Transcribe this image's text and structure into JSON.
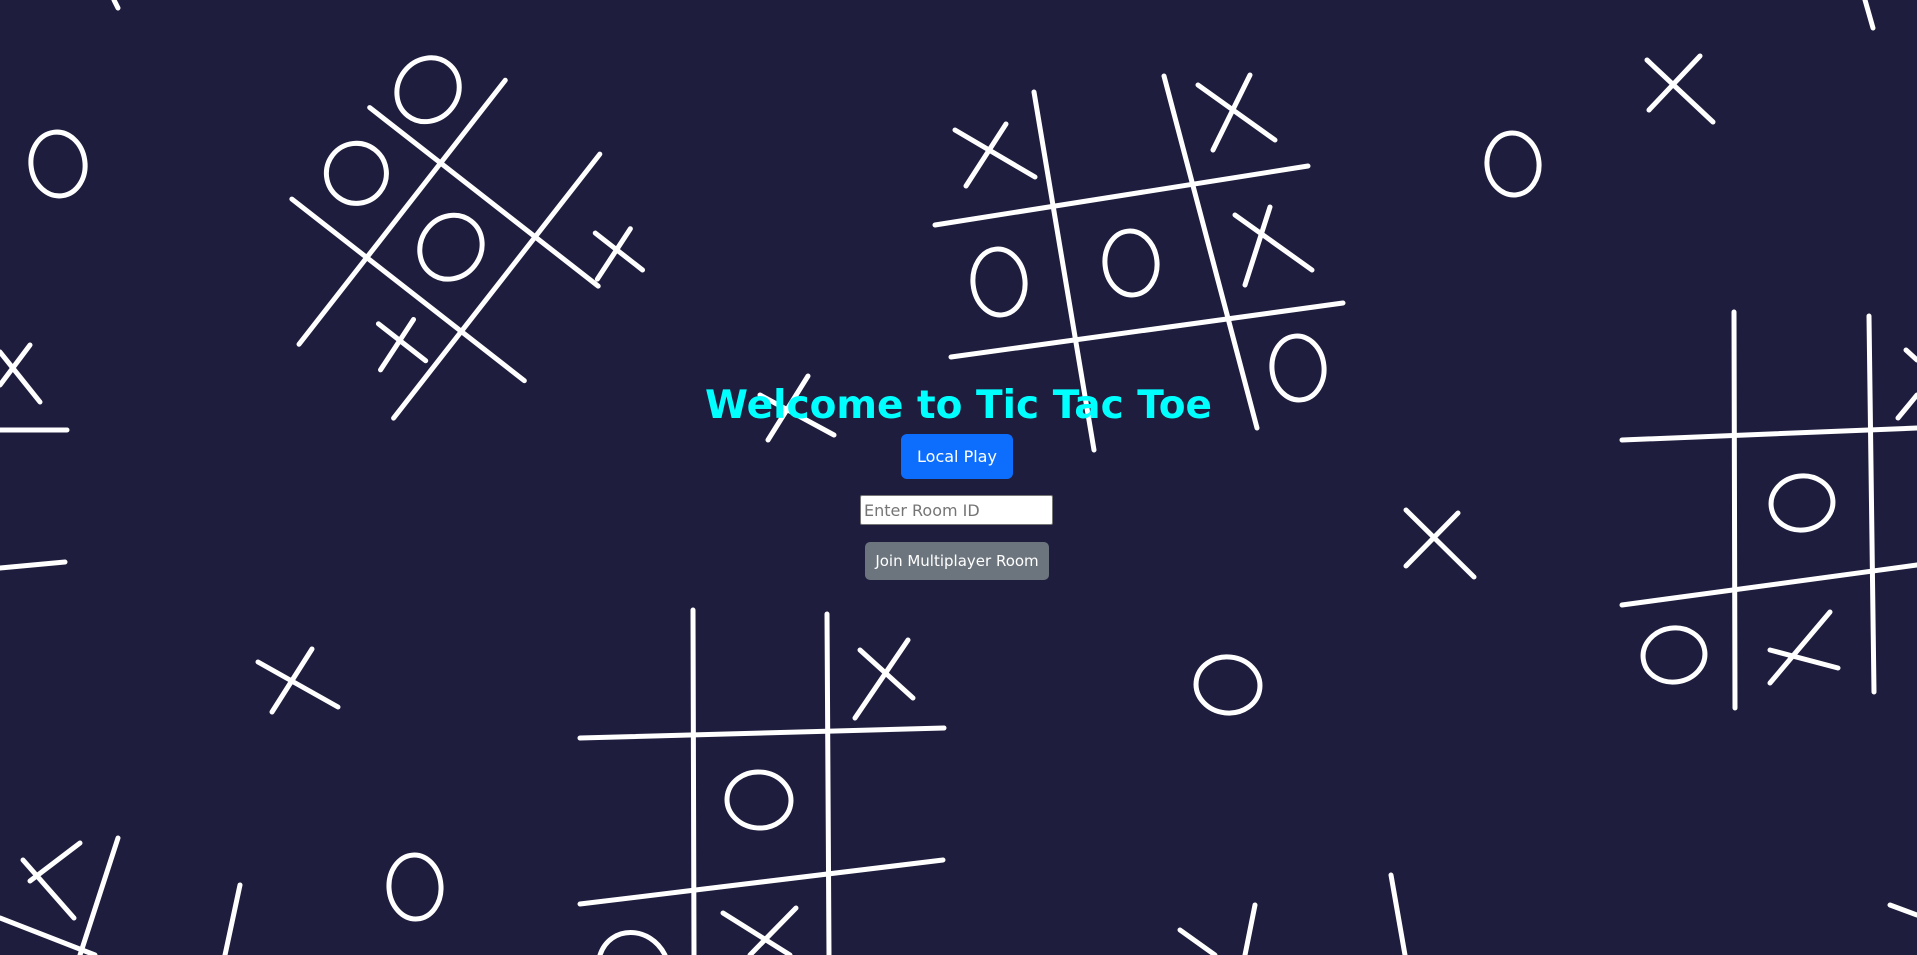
{
  "page": {
    "title": "Welcome to Tic Tac Toe",
    "background_color": "#1e1d3e",
    "doodle_color": "#ffffff",
    "title_color": "#00ffff"
  },
  "actions": {
    "local_play_label": "Local Play",
    "local_play_color": "#0d6efd",
    "room_input_value": "",
    "room_input_placeholder": "Enter Room ID",
    "join_label": "Join Multiplayer Room",
    "join_color": "#6c757d"
  },
  "background": {
    "pattern": "tic-tac-toe-doodles"
  }
}
